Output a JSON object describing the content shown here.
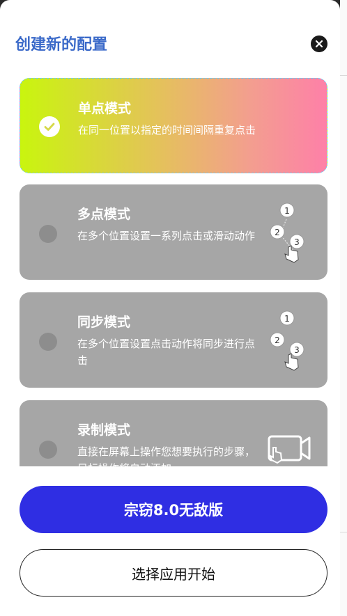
{
  "dialog": {
    "title": "创建新的配置",
    "close_icon": "close-icon"
  },
  "modes": [
    {
      "title": "单点模式",
      "description": "在同一位置以指定的时间间隔重复点击",
      "selected": true
    },
    {
      "title": "多点模式",
      "description": "在多个位置设置一系列点击或滑动动作",
      "selected": false,
      "icon": "multi-tap-icon",
      "icon_labels": [
        "1",
        "2",
        "3"
      ]
    },
    {
      "title": "同步模式",
      "description": "在多个位置设置点击动作将同步进行点击",
      "selected": false,
      "icon": "sync-tap-icon",
      "icon_labels": [
        "1",
        "2",
        "3"
      ]
    },
    {
      "title": "录制模式",
      "description": "直接在屏幕上操作您想要执行的步骤，目标操作将自动添加",
      "selected": false,
      "icon": "record-screen-icon"
    }
  ],
  "actions": {
    "primary_label": "宗窃8.0无敌版",
    "secondary_label": "选择应用开始"
  },
  "colors": {
    "title": "#3b6ac9",
    "primary_button": "#2f2ee3",
    "card_inactive": "#a6a6a6"
  }
}
